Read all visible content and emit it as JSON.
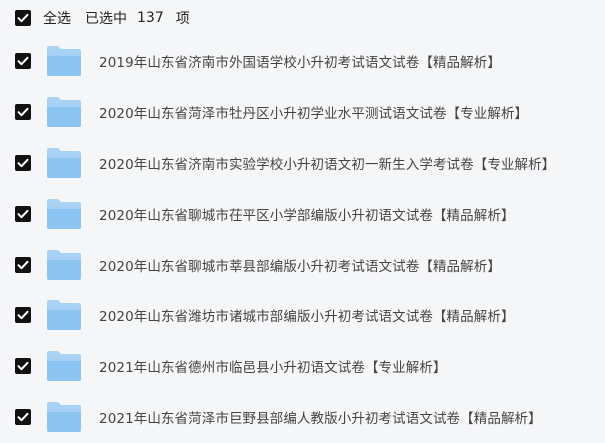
{
  "header": {
    "select_all_label": "全选",
    "selected_label": "已选中",
    "selected_count": "137",
    "unit_label": "项"
  },
  "files": [
    {
      "name": "2019年山东省济南市外国语学校小升初考试语文试卷【精品解析】",
      "checked": true
    },
    {
      "name": "2020年山东省菏泽市牡丹区小升初学业水平测试语文试卷【专业解析】",
      "checked": true
    },
    {
      "name": "2020年山东省济南市实验学校小升初语文初一新生入学考试卷【专业解析】",
      "checked": true
    },
    {
      "name": "2020年山东省聊城市茌平区小学部编版小升初语文试卷【精品解析】",
      "checked": true
    },
    {
      "name": "2020年山东省聊城市莘县部编版小升初考试语文试卷【精品解析】",
      "checked": true
    },
    {
      "name": "2020年山东省潍坊市诸城市部编版小升初考试语文试卷【精品解析】",
      "checked": true
    },
    {
      "name": "2021年山东省德州市临邑县小升初语文试卷【专业解析】",
      "checked": true
    },
    {
      "name": "2021年山东省菏泽市巨野县部编人教版小升初考试语文试卷【精品解析】",
      "checked": true
    }
  ],
  "icons": {
    "checkbox": "checkbox-checked-icon",
    "folder": "folder-icon"
  },
  "colors": {
    "checkbox_bg": "#111111",
    "folder_front": "#8cc4f2",
    "folder_back": "#a9d3f5",
    "background": "#f5f6f8"
  }
}
